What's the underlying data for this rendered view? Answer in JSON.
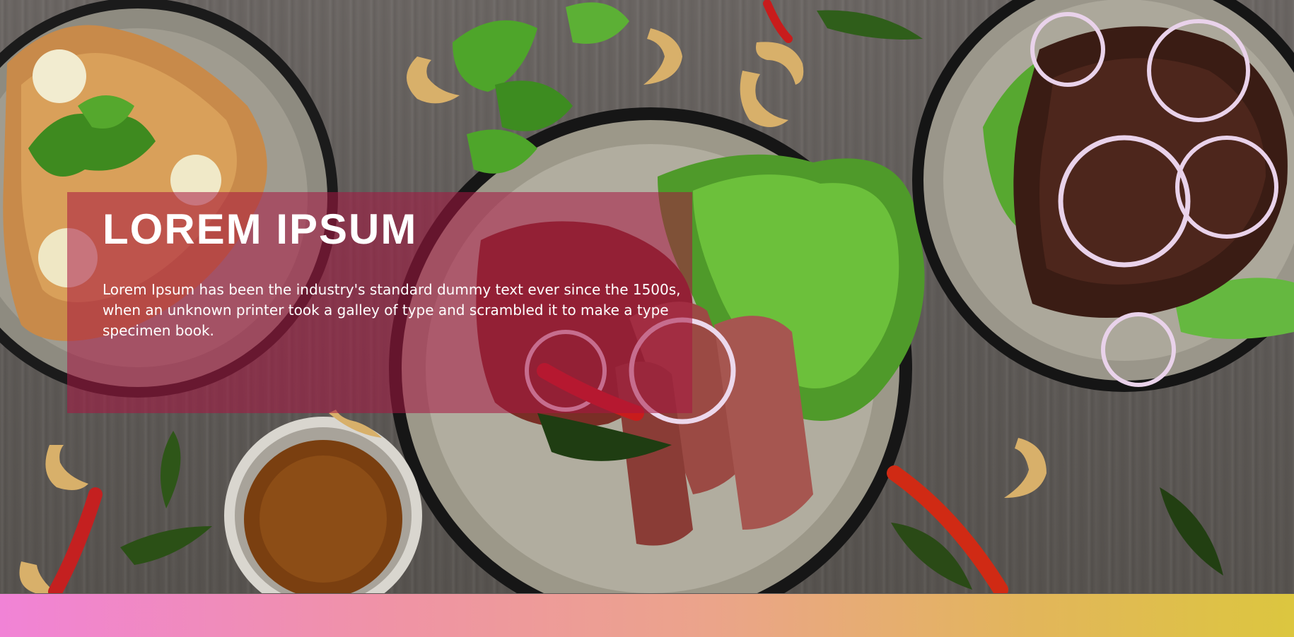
{
  "hero": {
    "title": "LOREM IPSUM",
    "description": "Lorem Ipsum has been the industry's standard dummy text ever since the 1500s, when an unknown printer took a galley of type and scrambled it to make a type specimen book.",
    "overlay_color": "#a81542",
    "background_photo": "food-on-wooden-table"
  },
  "footer_bar": {
    "gradient_start": "#f183d6",
    "gradient_end": "#dcc63f"
  }
}
